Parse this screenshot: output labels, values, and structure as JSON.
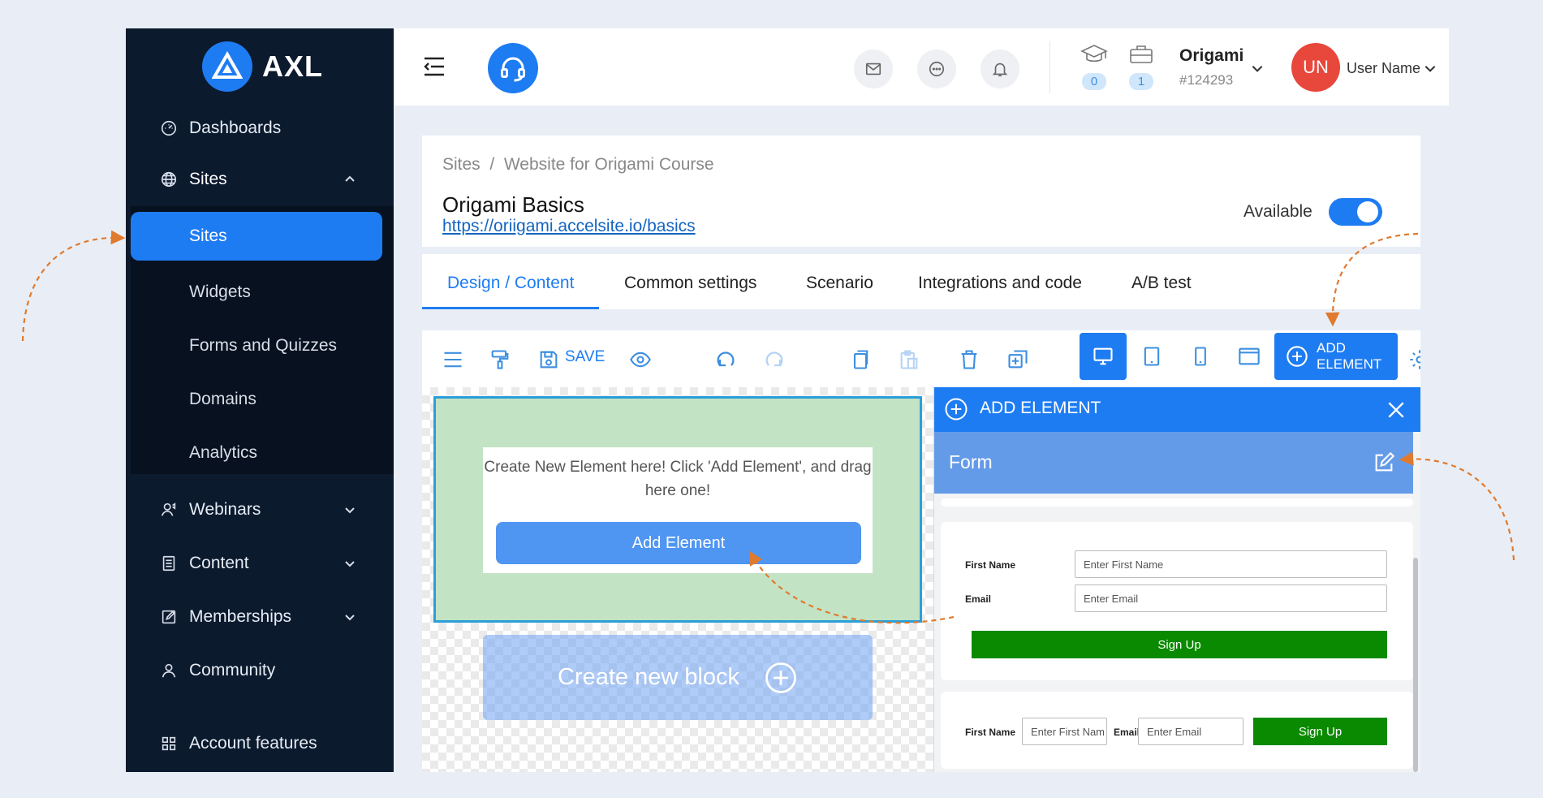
{
  "brand": {
    "name": "AXL",
    "accent": "#1e7cf2"
  },
  "sidebar": {
    "items": [
      {
        "label": "Dashboards",
        "icon": "gauge-icon"
      },
      {
        "label": "Sites",
        "icon": "globe-icon"
      },
      {
        "label": "Webinars",
        "icon": "webinar-icon"
      },
      {
        "label": "Content",
        "icon": "document-icon"
      },
      {
        "label": "Memberships",
        "icon": "edit-icon"
      },
      {
        "label": "Community",
        "icon": "person-icon"
      },
      {
        "label": "Account features",
        "icon": "grid-icon"
      }
    ],
    "sites_sub": [
      "Sites",
      "Widgets",
      "Forms and Quizzes",
      "Domains",
      "Analytics"
    ]
  },
  "header": {
    "courses_count": "0",
    "projects_count": "1",
    "project_name": "Origami",
    "project_id": "#124293",
    "avatar_initials": "UN",
    "user_name": "User Name"
  },
  "page": {
    "breadcrumb": "Sites  /  Website for Origami Course",
    "title": "Origami Basics",
    "url": "https://oriigami.accelsite.io/basics",
    "available_label": "Available"
  },
  "tabs": [
    "Design / Content",
    "Common settings",
    "Scenario",
    "Integrations and code",
    "A/B test"
  ],
  "toolbar": {
    "save_label": "SAVE",
    "add_element_line1": "ADD",
    "add_element_line2": "ELEMENT"
  },
  "canvas": {
    "placeholder_text": "Create New Element here! Click 'Add Element', and drag here one!",
    "add_element_button": "Add Element",
    "new_block_label": "Create new block"
  },
  "panel": {
    "title": "ADD ELEMENT",
    "section": "Form",
    "form1": {
      "first_name_label": "First Name",
      "first_name_placeholder": "Enter First Name",
      "email_label": "Email",
      "email_placeholder": "Enter Email",
      "button": "Sign Up"
    },
    "form2": {
      "first_name_label": "First Name",
      "first_name_placeholder": "Enter First Nam",
      "email_label": "Email",
      "email_placeholder": "Enter Email",
      "button": "Sign Up"
    }
  }
}
